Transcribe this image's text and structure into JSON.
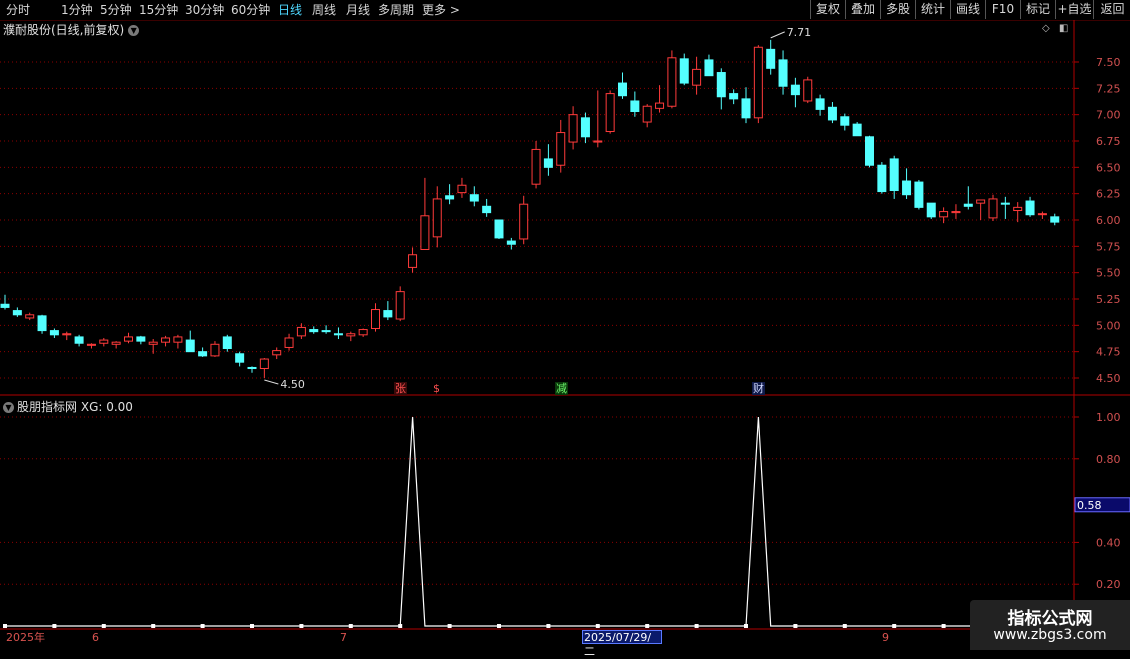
{
  "toolbar": {
    "periods": [
      "分时",
      "1分钟",
      "5分钟",
      "15分钟",
      "30分钟",
      "60分钟",
      "日线",
      "周线",
      "月线",
      "多周期",
      "更多 >"
    ],
    "active_period": "日线",
    "right_buttons": [
      "复权",
      "叠加",
      "多股",
      "统计",
      "画线",
      "F10",
      "标记",
      "+自选",
      "返回"
    ]
  },
  "main_panel": {
    "title": "濮耐股份(日线,前复权)",
    "y_ticks": [
      "7.50",
      "7.25",
      "7.00",
      "6.75",
      "6.50",
      "6.25",
      "6.00",
      "5.75",
      "5.50",
      "5.25",
      "5.00",
      "4.75",
      "4.50"
    ],
    "max_label": "7.71",
    "min_label": "4.50",
    "tags": [
      "张",
      "$",
      "减",
      "财"
    ]
  },
  "sub_panel": {
    "title": "股朋指标网",
    "series_label": "XG: 0.00",
    "y_ticks": [
      "1.00",
      "0.80",
      "0.40",
      "0.20"
    ],
    "current_value": "0.58"
  },
  "date_axis": {
    "labels": [
      "2025年",
      "6",
      "7",
      "9"
    ],
    "highlight": "2025/07/29/二"
  },
  "watermark": {
    "line1": "指标公式网",
    "line2": "www.zbgs3.com"
  },
  "colors": {
    "up": "#ff3b3b",
    "down": "#54ffff",
    "grid": "#8b0000",
    "axis": "#b00000",
    "line": "#ffffff"
  },
  "chart_data": [
    {
      "type": "candlestick",
      "title": "濮耐股份(日线,前复权)",
      "ylim": [
        4.4,
        7.7
      ],
      "y_ticks": [
        4.5,
        4.75,
        5.0,
        5.25,
        5.5,
        5.75,
        6.0,
        6.25,
        6.5,
        6.75,
        7.0,
        7.25,
        7.5
      ],
      "ohlc": [
        [
          5.2,
          5.29,
          5.15,
          5.17
        ],
        [
          5.14,
          5.17,
          5.08,
          5.1
        ],
        [
          5.07,
          5.12,
          5.05,
          5.1
        ],
        [
          5.09,
          5.1,
          4.92,
          4.95
        ],
        [
          4.95,
          4.97,
          4.88,
          4.91
        ],
        [
          4.91,
          4.94,
          4.86,
          4.92
        ],
        [
          4.89,
          4.91,
          4.8,
          4.83
        ],
        [
          4.81,
          4.83,
          4.78,
          4.82
        ],
        [
          4.83,
          4.88,
          4.8,
          4.86
        ],
        [
          4.82,
          4.85,
          4.78,
          4.84
        ],
        [
          4.85,
          4.93,
          4.83,
          4.89
        ],
        [
          4.89,
          4.9,
          4.82,
          4.85
        ],
        [
          4.82,
          4.87,
          4.73,
          4.84
        ],
        [
          4.84,
          4.9,
          4.8,
          4.88
        ],
        [
          4.84,
          4.91,
          4.78,
          4.89
        ],
        [
          4.86,
          4.95,
          4.82,
          4.75
        ],
        [
          4.75,
          4.79,
          4.7,
          4.71
        ],
        [
          4.71,
          4.85,
          4.7,
          4.82
        ],
        [
          4.89,
          4.91,
          4.75,
          4.78
        ],
        [
          4.73,
          4.75,
          4.61,
          4.65
        ],
        [
          4.6,
          4.61,
          4.55,
          4.59
        ],
        [
          4.59,
          4.69,
          4.5,
          4.68
        ],
        [
          4.72,
          4.79,
          4.68,
          4.76
        ],
        [
          4.79,
          4.92,
          4.76,
          4.88
        ],
        [
          4.9,
          5.02,
          4.87,
          4.98
        ],
        [
          4.96,
          4.99,
          4.92,
          4.94
        ],
        [
          4.95,
          5.0,
          4.92,
          4.94
        ],
        [
          4.92,
          4.98,
          4.87,
          4.91
        ],
        [
          4.9,
          4.94,
          4.85,
          4.92
        ],
        [
          4.91,
          4.97,
          4.89,
          4.96
        ],
        [
          4.97,
          5.21,
          4.94,
          5.15
        ],
        [
          5.14,
          5.23,
          5.05,
          5.08
        ],
        [
          5.06,
          5.37,
          5.04,
          5.32
        ],
        [
          5.55,
          5.74,
          5.5,
          5.67
        ],
        [
          5.72,
          6.4,
          5.72,
          6.04
        ],
        [
          5.84,
          6.32,
          5.74,
          6.2
        ],
        [
          6.23,
          6.34,
          6.15,
          6.2
        ],
        [
          6.26,
          6.4,
          6.21,
          6.33
        ],
        [
          6.24,
          6.32,
          6.13,
          6.18
        ],
        [
          6.13,
          6.2,
          6.03,
          6.07
        ],
        [
          6.0,
          6.0,
          5.82,
          5.83
        ],
        [
          5.8,
          5.83,
          5.72,
          5.77
        ],
        [
          5.82,
          6.23,
          5.77,
          6.15
        ],
        [
          6.34,
          6.75,
          6.3,
          6.67
        ],
        [
          6.58,
          6.72,
          6.42,
          6.5
        ],
        [
          6.52,
          6.95,
          6.45,
          6.83
        ],
        [
          6.74,
          7.08,
          6.67,
          7.0
        ],
        [
          6.97,
          7.02,
          6.73,
          6.79
        ],
        [
          6.74,
          7.23,
          6.69,
          6.75
        ],
        [
          6.84,
          7.23,
          6.82,
          7.2
        ],
        [
          7.3,
          7.4,
          7.15,
          7.18
        ],
        [
          7.13,
          7.22,
          6.98,
          7.03
        ],
        [
          6.93,
          7.1,
          6.88,
          7.08
        ],
        [
          7.06,
          7.28,
          7.02,
          7.11
        ],
        [
          7.08,
          7.61,
          7.06,
          7.54
        ],
        [
          7.53,
          7.58,
          7.28,
          7.3
        ],
        [
          7.28,
          7.55,
          7.19,
          7.43
        ],
        [
          7.52,
          7.57,
          7.37,
          7.37
        ],
        [
          7.4,
          7.44,
          7.05,
          7.17
        ],
        [
          7.2,
          7.24,
          7.1,
          7.15
        ],
        [
          7.15,
          7.26,
          6.92,
          6.97
        ],
        [
          6.97,
          7.66,
          6.92,
          7.64
        ],
        [
          7.62,
          7.71,
          7.38,
          7.44
        ],
        [
          7.52,
          7.61,
          7.19,
          7.27
        ],
        [
          7.28,
          7.35,
          7.07,
          7.19
        ],
        [
          7.13,
          7.36,
          7.11,
          7.33
        ],
        [
          7.15,
          7.19,
          6.99,
          7.05
        ],
        [
          7.07,
          7.12,
          6.92,
          6.95
        ],
        [
          6.98,
          7.01,
          6.85,
          6.9
        ],
        [
          6.91,
          6.93,
          6.8,
          6.8
        ],
        [
          6.79,
          6.8,
          6.5,
          6.52
        ],
        [
          6.52,
          6.55,
          6.25,
          6.27
        ],
        [
          6.58,
          6.61,
          6.2,
          6.28
        ],
        [
          6.37,
          6.49,
          6.2,
          6.24
        ],
        [
          6.36,
          6.38,
          6.1,
          6.12
        ],
        [
          6.16,
          6.16,
          6.01,
          6.03
        ],
        [
          6.03,
          6.12,
          5.97,
          6.08
        ],
        [
          6.07,
          6.15,
          6.01,
          6.08
        ],
        [
          6.15,
          6.32,
          6.1,
          6.13
        ],
        [
          6.16,
          6.18,
          6.0,
          6.19
        ],
        [
          6.02,
          6.24,
          5.99,
          6.2
        ],
        [
          6.16,
          6.22,
          6.01,
          6.15
        ],
        [
          6.09,
          6.17,
          5.98,
          6.12
        ],
        [
          6.18,
          6.22,
          6.03,
          6.05
        ],
        [
          6.06,
          6.08,
          6.01,
          6.06
        ],
        [
          6.03,
          6.06,
          5.95,
          5.98
        ]
      ]
    },
    {
      "type": "line",
      "title": "股朋指标网",
      "series": [
        {
          "name": "XG",
          "values": [
            0,
            0,
            0,
            0,
            0,
            0,
            0,
            0,
            0,
            0,
            0,
            0,
            0,
            0,
            0,
            0,
            0,
            0,
            0,
            0,
            0,
            0,
            0,
            0,
            0,
            0,
            0,
            0,
            0,
            0,
            0,
            0,
            0,
            1,
            0,
            0,
            0,
            0,
            0,
            0,
            0,
            0,
            0,
            0,
            0,
            0,
            0,
            0,
            0,
            0,
            0,
            0,
            0,
            0,
            0,
            0,
            0,
            0,
            0,
            0,
            0,
            1,
            0,
            0,
            0,
            0,
            0,
            0,
            0,
            0,
            0,
            0,
            0,
            0,
            0,
            0,
            0,
            0,
            0,
            0,
            0,
            0,
            0,
            0,
            0,
            0
          ]
        }
      ],
      "ylim": [
        0,
        1.05
      ],
      "y_ticks": [
        0.2,
        0.4,
        0.8,
        1.0
      ],
      "current_value": 0.58
    }
  ]
}
